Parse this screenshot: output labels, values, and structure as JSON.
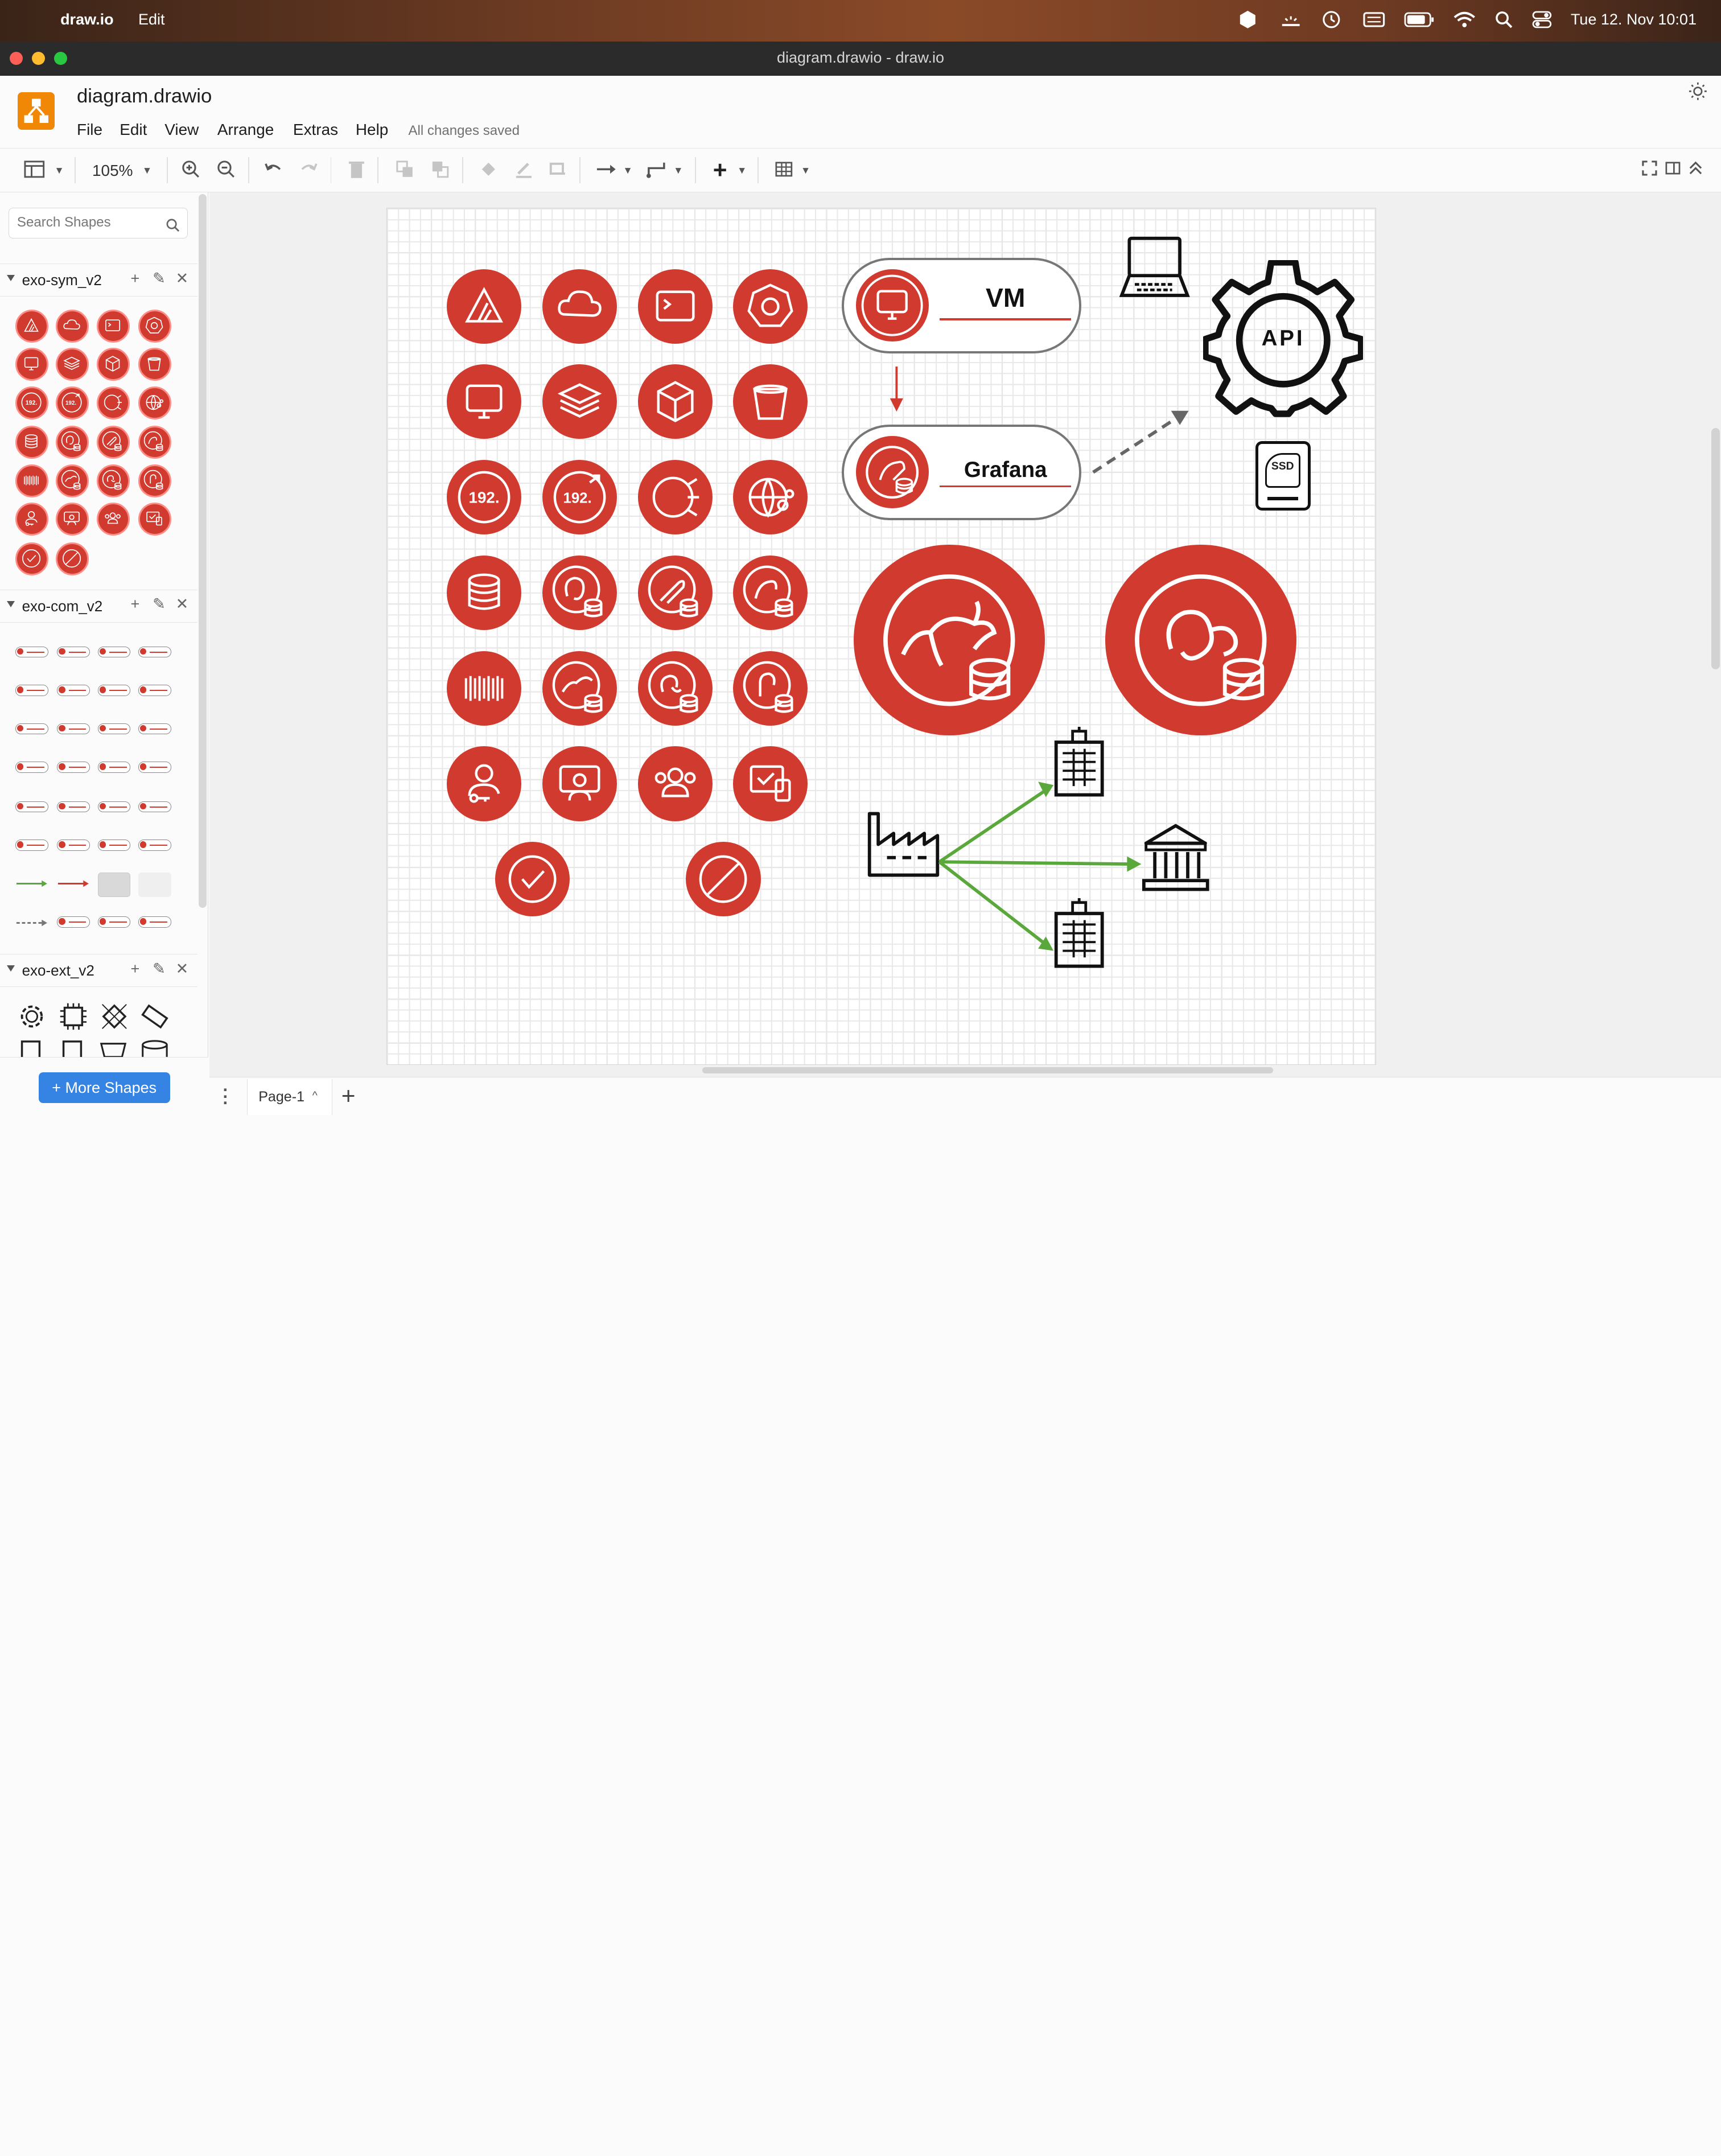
{
  "menubar": {
    "app_name": "draw.io",
    "edit_label": "Edit",
    "clock": "Tue 12. Nov  10:01"
  },
  "window": {
    "title": "diagram.drawio - draw.io"
  },
  "header": {
    "file_name": "diagram.drawio",
    "menus": [
      "File",
      "Edit",
      "View",
      "Arrange",
      "Extras",
      "Help"
    ],
    "save_status": "All changes saved"
  },
  "toolbar": {
    "zoom": "105%"
  },
  "sidebar": {
    "search_placeholder": "Search Shapes",
    "sections": [
      "exo-sym_v2",
      "exo-com_v2",
      "exo-ext_v2"
    ],
    "more_shapes": "More Shapes"
  },
  "diagram": {
    "vm_label": "VM",
    "grafana_label": "Grafana",
    "api_label": "API",
    "ssd_label": "SSD",
    "ip_label": "192.",
    "accent_red": "#d03a2f",
    "connector_green": "#5aa83c"
  },
  "tabs": {
    "page_name": "Page-1"
  }
}
